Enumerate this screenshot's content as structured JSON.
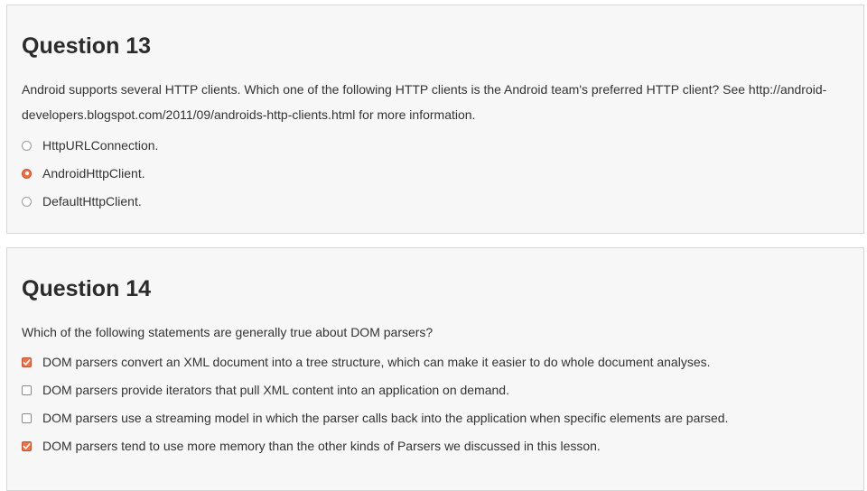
{
  "questions": [
    {
      "title": "Question 13",
      "text": "Android supports several HTTP clients. Which one of the following HTTP clients is the Android team's preferred HTTP client? See http://android-developers.blogspot.com/2011/09/androids-http-clients.html for more information.",
      "input_type": "radio",
      "options": [
        {
          "label": "HttpURLConnection.",
          "checked": false
        },
        {
          "label": "AndroidHttpClient.",
          "checked": true
        },
        {
          "label": "DefaultHttpClient.",
          "checked": false
        }
      ]
    },
    {
      "title": "Question 14",
      "text": "Which of the following statements are generally true about DOM parsers?",
      "input_type": "checkbox",
      "options": [
        {
          "label": "DOM parsers convert an XML document into a tree structure, which can make it easier to do whole document analyses.",
          "checked": true
        },
        {
          "label": "DOM parsers provide iterators that pull XML content into an application on demand.",
          "checked": false
        },
        {
          "label": "DOM parsers use a streaming model in which the parser calls back into the application when specific elements are parsed.",
          "checked": false
        },
        {
          "label": "DOM parsers tend to use more memory than the other kinds of Parsers we discussed in this lesson.",
          "checked": true
        }
      ]
    }
  ],
  "colors": {
    "accent": "#e9734a",
    "card_background": "#f7f7f7",
    "card_border": "#d6d6d6"
  }
}
